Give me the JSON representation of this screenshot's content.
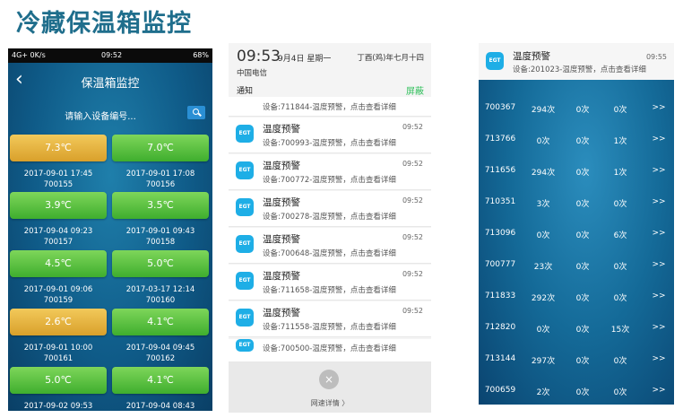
{
  "page_title": "冷藏保温箱监控",
  "phone1": {
    "status": {
      "left": "4G+ 0K/s",
      "time": "09:52",
      "right": "68%"
    },
    "header_title": "保温箱监控",
    "search_placeholder": "请输入设备编号...",
    "tiles": [
      {
        "temp": "7.3℃",
        "time": "2017-09-01 17:45",
        "id": "700155",
        "color": "orange"
      },
      {
        "temp": "7.0℃",
        "time": "2017-09-01 17:08",
        "id": "700156",
        "color": "green"
      },
      {
        "temp": "3.9℃",
        "time": "2017-09-04 09:23",
        "id": "700157",
        "color": "green"
      },
      {
        "temp": "3.5℃",
        "time": "2017-09-01 09:43",
        "id": "700158",
        "color": "green"
      },
      {
        "temp": "4.5℃",
        "time": "2017-09-01 09:06",
        "id": "700159",
        "color": "green"
      },
      {
        "temp": "5.0℃",
        "time": "2017-03-17 12:14",
        "id": "700160",
        "color": "green"
      },
      {
        "temp": "2.6℃",
        "time": "2017-09-01 10:00",
        "id": "700161",
        "color": "orange"
      },
      {
        "temp": "4.1℃",
        "time": "2017-09-04 09:45",
        "id": "700162",
        "color": "green"
      },
      {
        "temp": "5.0℃",
        "time": "2017-09-02 09:53",
        "id": "",
        "color": "green"
      },
      {
        "temp": "4.1℃",
        "time": "2017-09-04 08:43",
        "id": "",
        "color": "green"
      }
    ]
  },
  "phone2": {
    "time": "09:53",
    "date": "9月4日 星期一",
    "lunar": "丁酉(鸡)年七月十四",
    "carrier": "中国电信",
    "notice_label": "通知",
    "shield_label": "屏蔽",
    "icon_text": "EGT",
    "first_body": "设备:711844-温度预警，点击查看详细",
    "notifications": [
      {
        "title": "温度预警",
        "time": "09:52",
        "body": "设备:700993-温度预警，点击查看详细"
      },
      {
        "title": "温度预警",
        "time": "09:52",
        "body": "设备:700772-温度预警，点击查看详细"
      },
      {
        "title": "温度预警",
        "time": "09:52",
        "body": "设备:700278-温度预警，点击查看详细"
      },
      {
        "title": "温度预警",
        "time": "09:52",
        "body": "设备:700648-温度预警，点击查看详细"
      },
      {
        "title": "温度预警",
        "time": "09:52",
        "body": "设备:711658-温度预警，点击查看详细"
      },
      {
        "title": "温度预警",
        "time": "09:52",
        "body": "设备:711558-温度预警，点击查看详细"
      }
    ],
    "last_body": "设备:700500-温度预警，点击查看详细",
    "close_symbol": "×",
    "more_label": "网速详情 〉"
  },
  "phone3": {
    "notif": {
      "title": "温度预警",
      "time": "09:55",
      "body": "设备:201023-温度预警，点击查看详细"
    },
    "rows": [
      [
        "700367",
        "294次",
        "0次",
        "0次",
        ">>"
      ],
      [
        "713766",
        "0次",
        "0次",
        "1次",
        ">>"
      ],
      [
        "711656",
        "294次",
        "0次",
        "1次",
        ">>"
      ],
      [
        "710351",
        "3次",
        "0次",
        "0次",
        ">>"
      ],
      [
        "713096",
        "0次",
        "0次",
        "6次",
        ">>"
      ],
      [
        "700777",
        "23次",
        "0次",
        "0次",
        ">>"
      ],
      [
        "711833",
        "292次",
        "0次",
        "0次",
        ">>"
      ],
      [
        "712820",
        "0次",
        "0次",
        "15次",
        ">>"
      ],
      [
        "713144",
        "297次",
        "0次",
        "0次",
        ">>"
      ],
      [
        "700659",
        "2次",
        "0次",
        "0次",
        ">>"
      ]
    ]
  }
}
